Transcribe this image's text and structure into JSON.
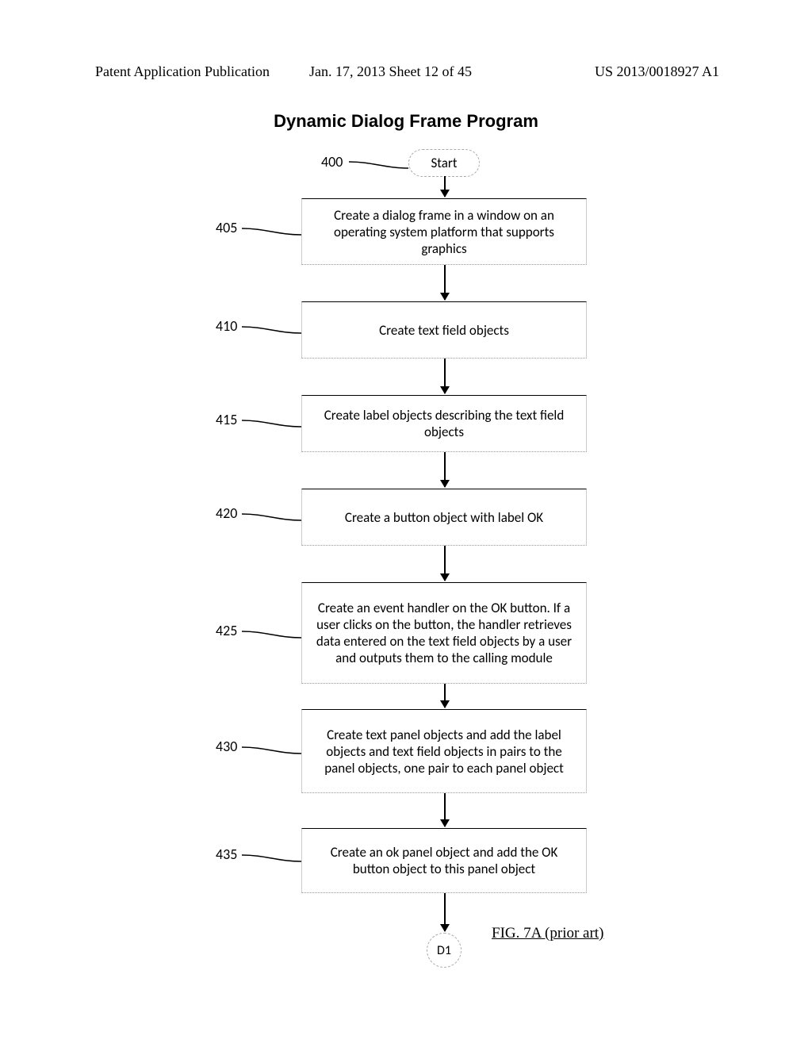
{
  "header": {
    "left": "Patent Application Publication",
    "mid": "Jan. 17, 2013  Sheet 12 of 45",
    "right": "US 2013/0018927 A1"
  },
  "title": "Dynamic Dialog Frame Program",
  "figure_label": "FIG. 7A (prior art)",
  "labels": {
    "l400": "400",
    "l405": "405",
    "l410": "410",
    "l415": "415",
    "l420": "420",
    "l425": "425",
    "l430": "430",
    "l435": "435"
  },
  "nodes": {
    "start": "Start",
    "s405": "Create a dialog frame in a window on an operating system platform that supports graphics",
    "s410": "Create text field objects",
    "s415": "Create label objects describing the text field objects",
    "s420": "Create a button object with label OK",
    "s425": "Create an event handler on the OK button. If a user clicks on the button, the handler retrieves data entered on the text field objects by a user and outputs them to the calling module",
    "s430": "Create text panel objects and add the label objects and text field objects in pairs to the panel objects, one pair to each panel object",
    "s435": "Create an ok panel object  and add the OK button object to this panel object",
    "d1": "D1"
  }
}
